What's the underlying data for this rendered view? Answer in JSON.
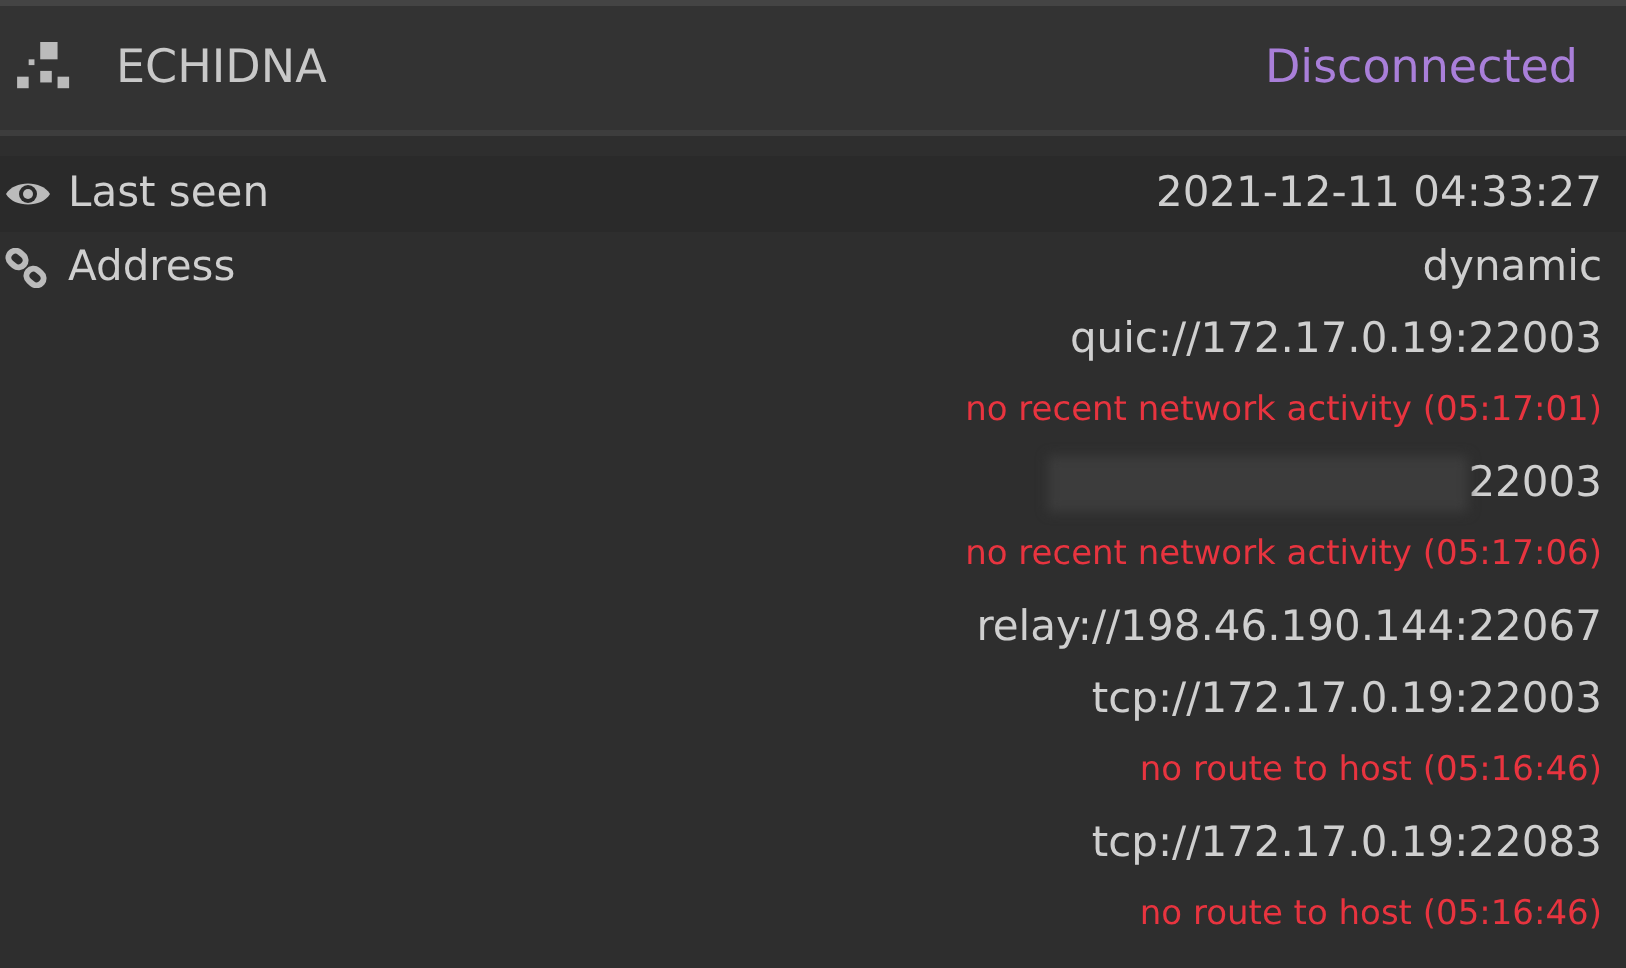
{
  "device": {
    "name": "ECHIDNA",
    "status": "Disconnected"
  },
  "last_seen": {
    "label": "Last seen",
    "value": "2021-12-11 04:33:27"
  },
  "address": {
    "label": "Address",
    "lines": [
      {
        "kind": "address",
        "text": "dynamic"
      },
      {
        "kind": "address",
        "text": "quic://172.17.0.19:22003"
      },
      {
        "kind": "error",
        "text": "no recent network activity (05:17:01)"
      },
      {
        "kind": "redacted",
        "text": "22003"
      },
      {
        "kind": "error",
        "text": "no recent network activity (05:17:06)"
      },
      {
        "kind": "address",
        "text": "relay://198.46.190.144:22067"
      },
      {
        "kind": "address",
        "text": "tcp://172.17.0.19:22003"
      },
      {
        "kind": "error",
        "text": "no route to host (05:16:46)"
      },
      {
        "kind": "address",
        "text": "tcp://172.17.0.19:22083"
      },
      {
        "kind": "error",
        "text": "no route to host (05:16:46)"
      }
    ]
  }
}
